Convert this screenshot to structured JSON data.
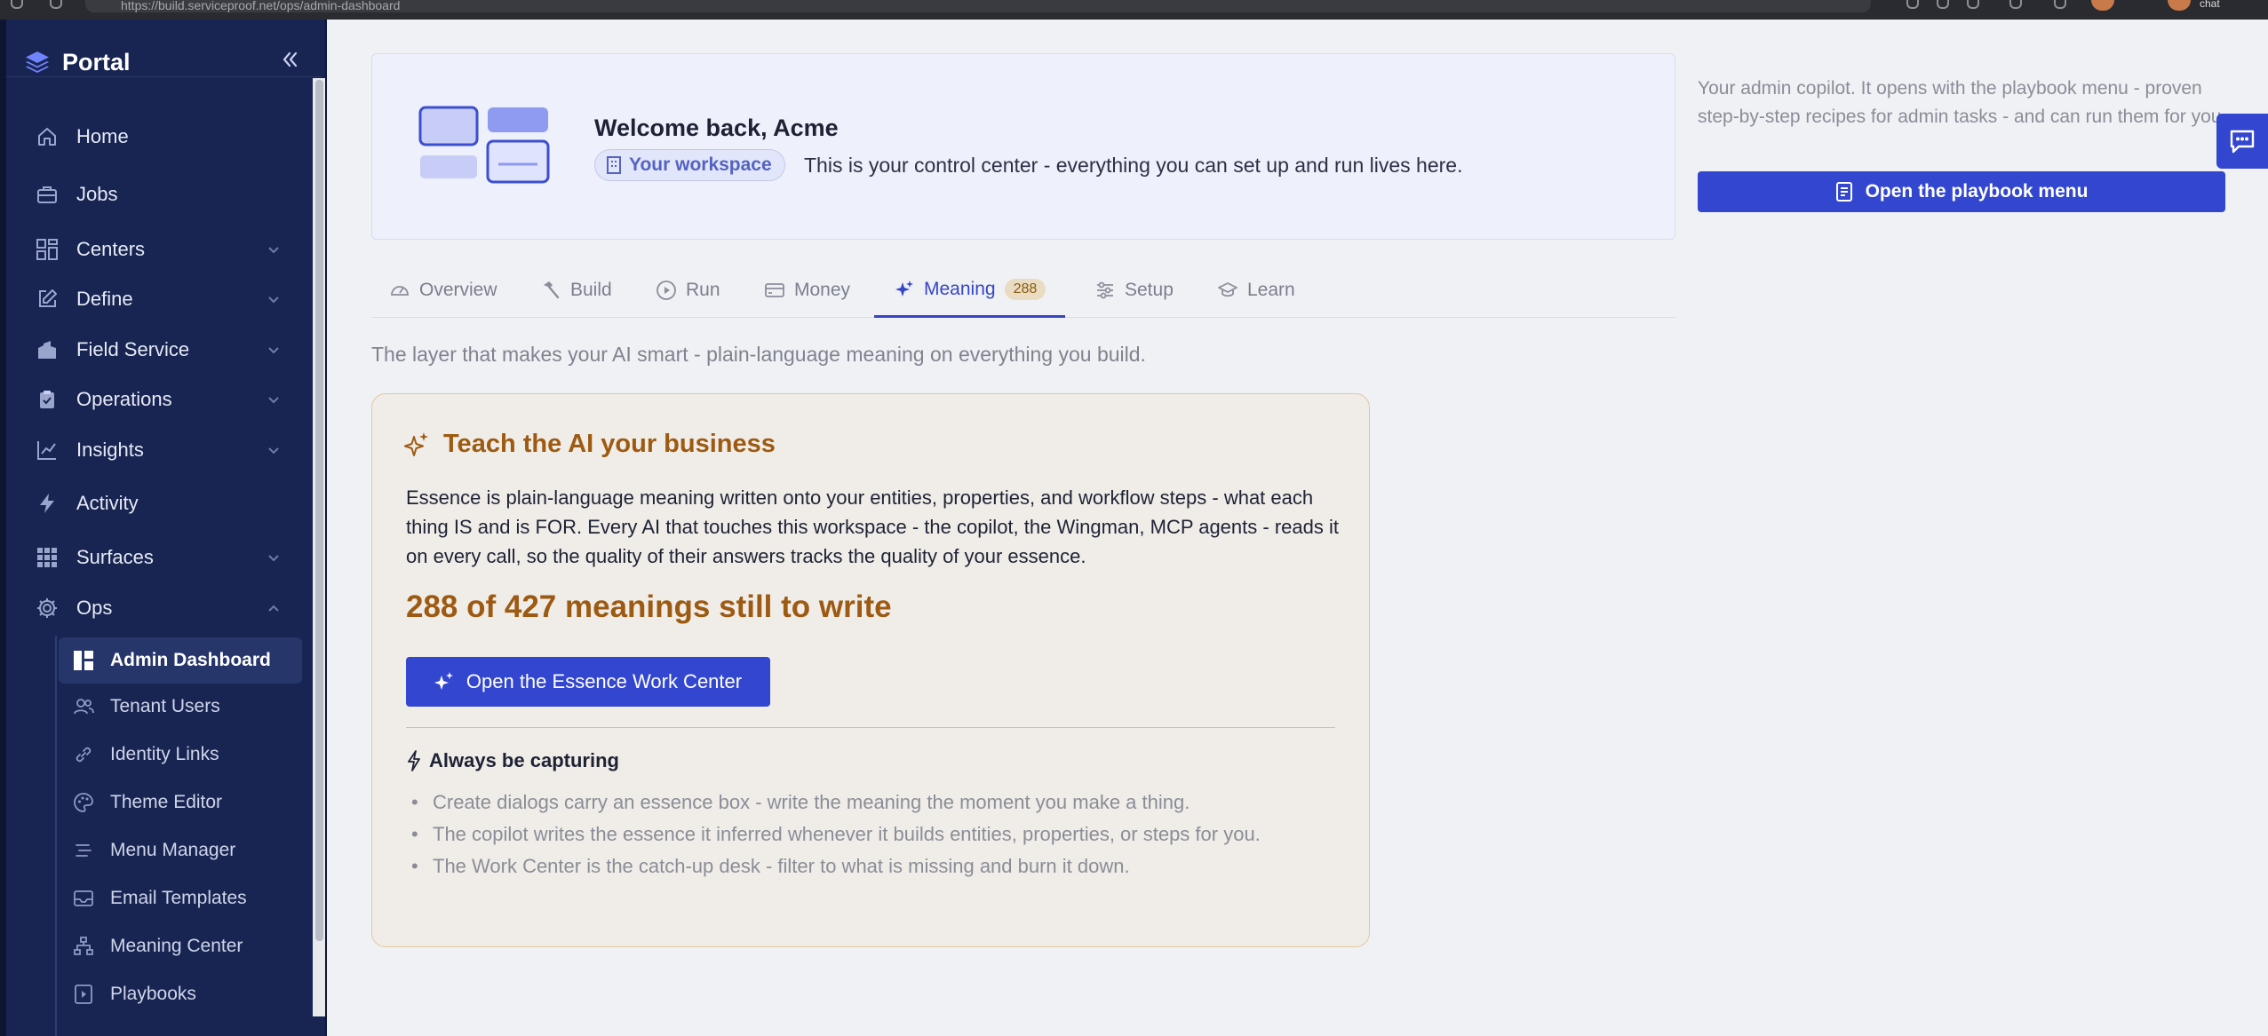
{
  "browser": {
    "url": "https://build.serviceproof.net/ops/admin-dashboard",
    "user": "chat"
  },
  "brand": {
    "name": "Portal"
  },
  "sidebar": {
    "items": [
      {
        "label": "Home",
        "icon": "home-icon"
      },
      {
        "label": "Jobs",
        "icon": "briefcase-icon"
      },
      {
        "label": "Centers",
        "icon": "grid-icon"
      },
      {
        "label": "Define",
        "icon": "edit-icon"
      },
      {
        "label": "Field Service",
        "icon": "building-icon"
      },
      {
        "label": "Operations",
        "icon": "clipboard-icon"
      },
      {
        "label": "Insights",
        "icon": "chart-line-icon"
      },
      {
        "label": "Activity",
        "icon": "bolt-icon"
      },
      {
        "label": "Surfaces",
        "icon": "apps-icon"
      },
      {
        "label": "Ops",
        "icon": "gear-icon"
      }
    ],
    "ops_items": [
      {
        "label": "Admin Dashboard",
        "icon": "dashboard-icon",
        "active": true
      },
      {
        "label": "Tenant Users",
        "icon": "users-icon"
      },
      {
        "label": "Identity Links",
        "icon": "link-icon"
      },
      {
        "label": "Theme Editor",
        "icon": "palette-icon"
      },
      {
        "label": "Menu Manager",
        "icon": "menu-icon"
      },
      {
        "label": "Email Templates",
        "icon": "mail-icon"
      },
      {
        "label": "Meaning Center",
        "icon": "hierarchy-icon"
      },
      {
        "label": "Playbooks",
        "icon": "playbook-icon"
      }
    ]
  },
  "welcome": {
    "title": "Welcome back, Acme",
    "badge": "Your workspace",
    "subtitle": "This is your control center - everything you can set up and run lives here."
  },
  "copilot": {
    "text": "Your admin copilot. It opens with the playbook menu - proven step-by-step recipes for admin tasks - and can run them for you.",
    "button": "Open the playbook menu"
  },
  "tabs": [
    {
      "label": "Overview"
    },
    {
      "label": "Build"
    },
    {
      "label": "Run"
    },
    {
      "label": "Money"
    },
    {
      "label": "Meaning",
      "count": "288",
      "active": true
    },
    {
      "label": "Setup"
    },
    {
      "label": "Learn"
    }
  ],
  "tagline": "The layer that makes your AI smart - plain-language meaning on everything you build.",
  "teach": {
    "title": "Teach the AI your business",
    "body": "Essence is plain-language meaning written onto your entities, properties, and workflow steps - what each thing IS and is FOR. Every AI that touches this workspace - the copilot, the Wingman, MCP agents - reads it on every call, so the quality of their answers tracks the quality of your essence.",
    "count_text": "288 of 427 meanings still to write",
    "meanings_remaining": 288,
    "meanings_total": 427,
    "button": "Open the Essence Work Center",
    "capture_title": "Always be capturing",
    "capture_items": [
      "Create dialogs carry an essence box - write the meaning the moment you make a thing.",
      "The copilot writes the essence it inferred whenever it builds entities, properties, or steps for you.",
      "The Work Center is the catch-up desk - filter to what is missing and burn it down."
    ]
  },
  "colors": {
    "sidebar": "#182552",
    "accent": "#3246cf",
    "amber": "#9d5a12",
    "card_bg": "#f0ede8"
  }
}
